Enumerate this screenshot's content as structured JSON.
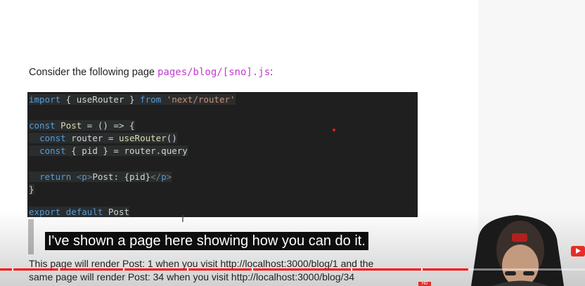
{
  "article": {
    "intro_text": "Consider the following page ",
    "intro_path": "pages/blog/[sno].js",
    "intro_end": ":",
    "paragraph_line1": "This page will render Post: 1 when you visit http://localhost:3000/blog/1 and the",
    "paragraph_line2": "same page will render Post: 34 when you visit http://localhost:3000/blog/34"
  },
  "code": {
    "l1_import": "import",
    "l1_open": " { ",
    "l1_name": "useRouter",
    "l1_close": " } ",
    "l1_from": "from",
    "l1_space": " ",
    "l1_str": "'next/router'",
    "l3_const": "const",
    "l3_name": " Post",
    "l3_rest": " = () => {",
    "l4_indent": "  ",
    "l4_const": "const",
    "l4_mid": " router = ",
    "l4_fn": "useRouter",
    "l4_end": "()",
    "l5_indent": "  ",
    "l5_const": "const",
    "l5_rest": " { pid } = router.query",
    "l7_indent": "  ",
    "l7_return": "return",
    "l7_sp": " ",
    "l7_open_lt": "<",
    "l7_open_tag": "p",
    "l7_open_gt": ">",
    "l7_text": "Post: {pid}",
    "l7_close_lt": "</",
    "l7_close_tag": "p",
    "l7_close_gt": ">",
    "l8_brace": "}",
    "l10_export": "export",
    "l10_sp": " ",
    "l10_default": "default",
    "l10_name": " Post"
  },
  "overlay": {
    "caption": "I've shown a page here showing how you can do it.",
    "ibeam_glyph": "I",
    "hd_label": "HD"
  },
  "video": {
    "progress": 0.8,
    "chapter_marks": [
      0.02,
      0.1,
      0.21,
      0.32,
      0.43,
      0.6,
      0.72
    ],
    "accent": "#ff0000"
  },
  "icons": {
    "youtube": "youtube-logo-icon",
    "cursor": "text-cursor-icon"
  }
}
